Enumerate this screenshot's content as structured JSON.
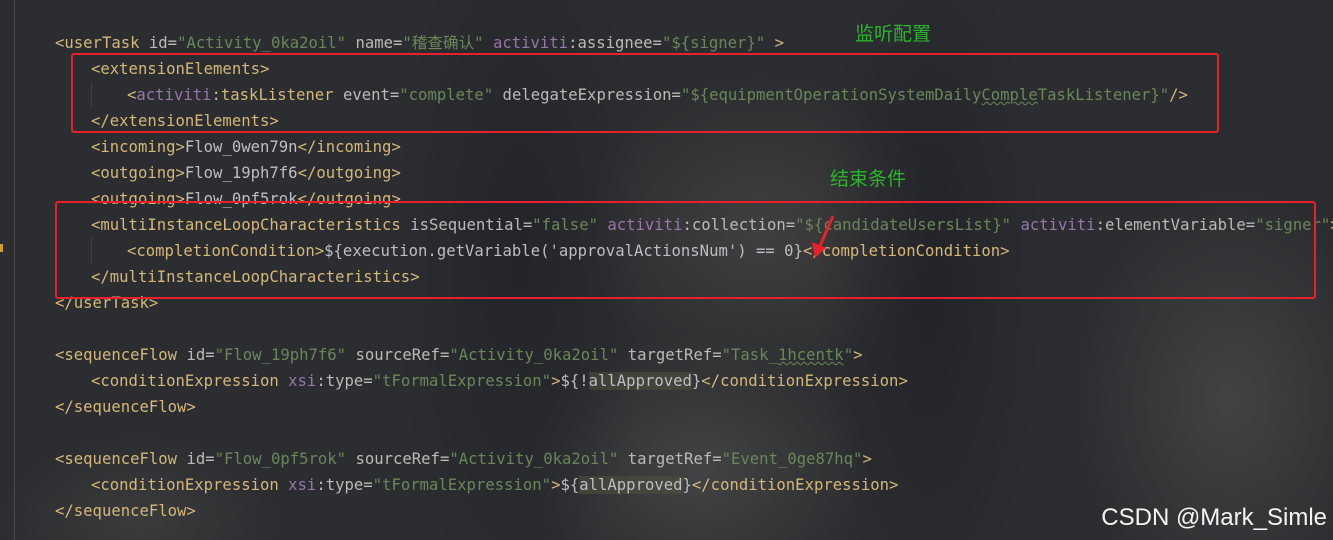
{
  "annotations": {
    "listener_config": "监听配置",
    "end_condition": "结束条件"
  },
  "watermark": "CSDN @Mark_Simle",
  "colors": {
    "tag": "#d5b778",
    "attribute": "#bababa",
    "namespace": "#9876aa",
    "string": "#6a8759",
    "text": "#bcbec4",
    "highlight_box": "#e8202a",
    "annotation": "#2ab52a"
  },
  "code": {
    "l1": {
      "open": "<userTask",
      "a1": " id=",
      "v1": "\"Activity_0ka2oil\"",
      "a2": " name=",
      "v2": "\"稽查确认\"",
      "ns": " activiti",
      "a3": ":assignee=",
      "v3": "\"${signer}\"",
      "close": " >"
    },
    "l2": {
      "text": "<extensionElements>"
    },
    "l3": {
      "lt": "<",
      "ns": "activiti",
      "tag": ":taskListener",
      "a1": " event=",
      "v1": "\"complete\"",
      "a2": " delegateExpression=",
      "v2a": "\"${equipmentOperationSystemDaily",
      "v2b": "Comple",
      "v2c": "TaskListener}\"",
      "close": "/>"
    },
    "l4": {
      "text": "</extensionElements>"
    },
    "l5": {
      "open": "<incoming>",
      "value": "Flow_0wen79n",
      "close": "</incoming>"
    },
    "l6": {
      "open": "<outgoing>",
      "value": "Flow_19ph7f6",
      "close": "</outgoing>"
    },
    "l7": {
      "open": "<outgoing>",
      "value": "Flow_0pf5rok",
      "close": "</outgoing>"
    },
    "l8": {
      "open": "<multiInstanceLoopCharacteristics",
      "a1": " isSequential=",
      "v1": "\"false\"",
      "ns1": " activiti",
      "a2": ":collection=",
      "v2": "\"${candidateUsersList}\"",
      "ns2": " activiti",
      "a3": ":elementVariable=",
      "v3": "\"signer\"",
      "close": ">"
    },
    "l9": {
      "open": "<completionCondition>",
      "value": "${execution.getVariable('approvalActionsNum') == 0}",
      "close": "</completionCondition>"
    },
    "l10": {
      "text": "</multiInstanceLoopCharacteristics>"
    },
    "l11": {
      "text": "</userTask>"
    },
    "l12": {
      "open": "<sequenceFlow",
      "a1": " id=",
      "v1": "\"Flow_19ph7f6\"",
      "a2": " sourceRef=",
      "v2": "\"Activity_0ka2oil\"",
      "a3": " targetRef=",
      "v3a": "\"Task_",
      "v3b": "1hcentk",
      "v3c": "\"",
      "close": ">"
    },
    "l13": {
      "open": "<conditionExpression",
      "ns": " xsi",
      "a1": ":type=",
      "v1": "\"tFormalExpression\"",
      "gt": ">",
      "pre": "${!",
      "var": "allApproved",
      "post": "}",
      "close": "</conditionExpression>"
    },
    "l14": {
      "text": "</sequenceFlow>"
    },
    "l15": {
      "open": "<sequenceFlow",
      "a1": " id=",
      "v1": "\"Flow_0pf5rok\"",
      "a2": " sourceRef=",
      "v2": "\"Activity_0ka2oil\"",
      "a3": " targetRef=",
      "v3": "\"Event_0ge87hq\"",
      "close": ">"
    },
    "l16": {
      "open": "<conditionExpression",
      "ns": " xsi",
      "a1": ":type=",
      "v1": "\"tFormalExpression\"",
      "gt": ">",
      "pre": "${",
      "var": "allApproved",
      "post": "}",
      "close": "</conditionExpression>"
    },
    "l17": {
      "text": "</sequenceFlow>"
    }
  }
}
